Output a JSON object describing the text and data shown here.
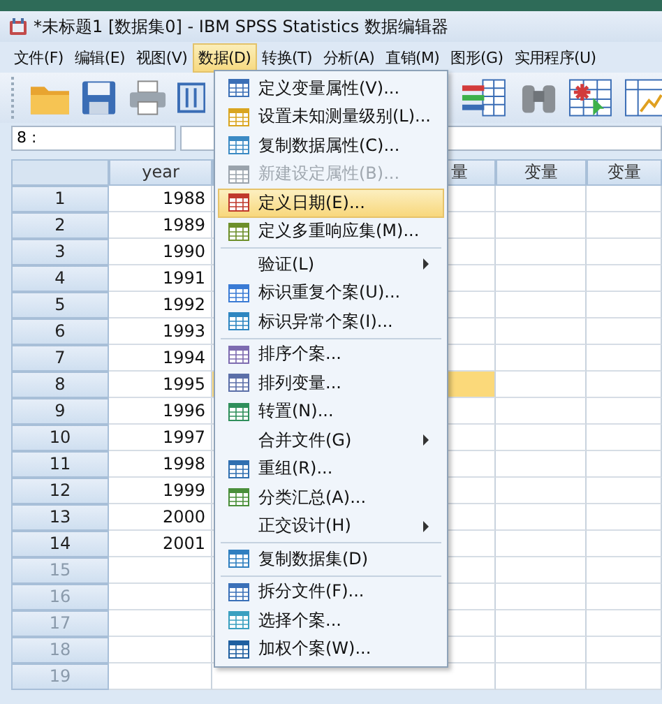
{
  "window": {
    "title": "*未标题1 [数据集0] - IBM SPSS Statistics 数据编辑器"
  },
  "menu_bar": [
    {
      "label": "文件(F)",
      "selected": false
    },
    {
      "label": "编辑(E)",
      "selected": false
    },
    {
      "label": "视图(V)",
      "selected": false
    },
    {
      "label": "数据(D)",
      "selected": true
    },
    {
      "label": "转换(T)",
      "selected": false
    },
    {
      "label": "分析(A)",
      "selected": false
    },
    {
      "label": "直销(M)",
      "selected": false
    },
    {
      "label": "图形(G)",
      "selected": false
    },
    {
      "label": "实用程序(U)",
      "selected": false
    }
  ],
  "cell_editor": {
    "cell_ref": "8 :"
  },
  "grid": {
    "columns": [
      "year",
      "量",
      "变量",
      "变量"
    ],
    "rows": [
      {
        "number": "1",
        "cells": [
          "1988"
        ],
        "has_data": true,
        "selected": false
      },
      {
        "number": "2",
        "cells": [
          "1989"
        ],
        "has_data": true,
        "selected": false
      },
      {
        "number": "3",
        "cells": [
          "1990"
        ],
        "has_data": true,
        "selected": false
      },
      {
        "number": "4",
        "cells": [
          "1991"
        ],
        "has_data": true,
        "selected": false
      },
      {
        "number": "5",
        "cells": [
          "1992"
        ],
        "has_data": true,
        "selected": false
      },
      {
        "number": "6",
        "cells": [
          "1993"
        ],
        "has_data": true,
        "selected": false
      },
      {
        "number": "7",
        "cells": [
          "1994"
        ],
        "has_data": true,
        "selected": false
      },
      {
        "number": "8",
        "cells": [
          "1995"
        ],
        "has_data": true,
        "selected": true
      },
      {
        "number": "9",
        "cells": [
          "1996"
        ],
        "has_data": true,
        "selected": false
      },
      {
        "number": "10",
        "cells": [
          "1997"
        ],
        "has_data": true,
        "selected": false
      },
      {
        "number": "11",
        "cells": [
          "1998"
        ],
        "has_data": true,
        "selected": false
      },
      {
        "number": "12",
        "cells": [
          "1999"
        ],
        "has_data": true,
        "selected": false
      },
      {
        "number": "13",
        "cells": [
          "2000"
        ],
        "has_data": true,
        "selected": false
      },
      {
        "number": "14",
        "cells": [
          "2001"
        ],
        "has_data": true,
        "selected": false
      },
      {
        "number": "15",
        "cells": [
          ""
        ],
        "has_data": false,
        "selected": false
      },
      {
        "number": "16",
        "cells": [
          ""
        ],
        "has_data": false,
        "selected": false
      },
      {
        "number": "17",
        "cells": [
          ""
        ],
        "has_data": false,
        "selected": false
      },
      {
        "number": "18",
        "cells": [
          ""
        ],
        "has_data": false,
        "selected": false
      },
      {
        "number": "19",
        "cells": [
          ""
        ],
        "has_data": false,
        "selected": false
      }
    ]
  },
  "data_menu": [
    {
      "kind": "command",
      "label": "定义变量属性(V)...",
      "disabled": false,
      "selected": false
    },
    {
      "kind": "command",
      "label": "设置未知测量级别(L)...",
      "disabled": false,
      "selected": false
    },
    {
      "kind": "command",
      "label": "复制数据属性(C)...",
      "disabled": false,
      "selected": false
    },
    {
      "kind": "command",
      "label": "新建设定属性(B)...",
      "disabled": true,
      "selected": false
    },
    {
      "kind": "command",
      "label": "定义日期(E)...",
      "disabled": false,
      "selected": true
    },
    {
      "kind": "command",
      "label": "定义多重响应集(M)...",
      "disabled": false,
      "selected": false
    },
    {
      "kind": "separator"
    },
    {
      "kind": "submenu",
      "label": "验证(L)",
      "disabled": false,
      "selected": false
    },
    {
      "kind": "command",
      "label": "标识重复个案(U)...",
      "disabled": false,
      "selected": false
    },
    {
      "kind": "command",
      "label": "标识异常个案(I)...",
      "disabled": false,
      "selected": false
    },
    {
      "kind": "separator"
    },
    {
      "kind": "command",
      "label": "排序个案...",
      "disabled": false,
      "selected": false
    },
    {
      "kind": "command",
      "label": "排列变量...",
      "disabled": false,
      "selected": false
    },
    {
      "kind": "command",
      "label": "转置(N)...",
      "disabled": false,
      "selected": false
    },
    {
      "kind": "submenu",
      "label": "合并文件(G)",
      "disabled": false,
      "selected": false
    },
    {
      "kind": "command",
      "label": "重组(R)...",
      "disabled": false,
      "selected": false
    },
    {
      "kind": "command",
      "label": "分类汇总(A)...",
      "disabled": false,
      "selected": false
    },
    {
      "kind": "submenu",
      "label": "正交设计(H)",
      "disabled": false,
      "selected": false
    },
    {
      "kind": "separator"
    },
    {
      "kind": "command",
      "label": "复制数据集(D)",
      "disabled": false,
      "selected": false
    },
    {
      "kind": "separator"
    },
    {
      "kind": "command",
      "label": "拆分文件(F)...",
      "disabled": false,
      "selected": false
    },
    {
      "kind": "command",
      "label": "选择个案...",
      "disabled": false,
      "selected": false
    },
    {
      "kind": "command",
      "label": "加权个案(W)...",
      "disabled": false,
      "selected": false
    }
  ]
}
